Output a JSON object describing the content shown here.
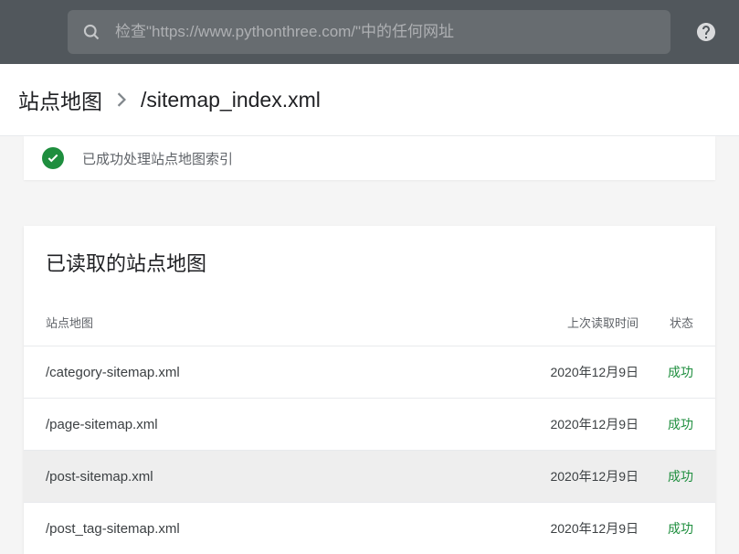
{
  "search": {
    "placeholder": "检查\"https://www.pythonthree.com/\"中的任何网址"
  },
  "breadcrumb": {
    "root": "站点地图",
    "current": "/sitemap_index.xml"
  },
  "status_banner": {
    "text": "已成功处理站点地图索引"
  },
  "card": {
    "title": "已读取的站点地图",
    "headers": {
      "url": "站点地图",
      "date": "上次读取时间",
      "status": "状态"
    },
    "rows": [
      {
        "url": "/category-sitemap.xml",
        "date": "2020年12月9日",
        "status": "成功",
        "highlighted": false
      },
      {
        "url": "/page-sitemap.xml",
        "date": "2020年12月9日",
        "status": "成功",
        "highlighted": false
      },
      {
        "url": "/post-sitemap.xml",
        "date": "2020年12月9日",
        "status": "成功",
        "highlighted": true
      },
      {
        "url": "/post_tag-sitemap.xml",
        "date": "2020年12月9日",
        "status": "成功",
        "highlighted": false
      }
    ]
  }
}
